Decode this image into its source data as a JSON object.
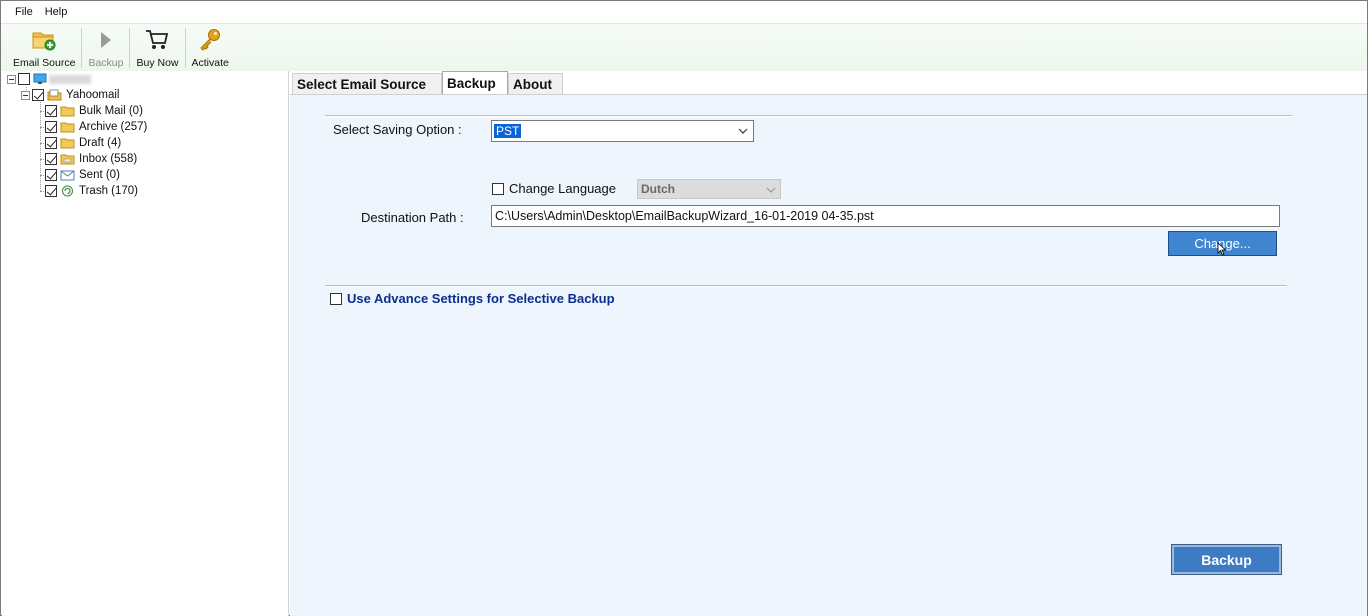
{
  "menu": [
    "File",
    "Help"
  ],
  "toolbar": {
    "email_source": "Email Source",
    "backup": "Backup",
    "buy_now": "Buy Now",
    "activate": "Activate"
  },
  "tree": {
    "account": "Yahoomail",
    "folders": [
      {
        "label": "Bulk Mail (0)",
        "icon": "folder-icon"
      },
      {
        "label": "Archive (257)",
        "icon": "folder-icon"
      },
      {
        "label": "Draft (4)",
        "icon": "folder-icon"
      },
      {
        "label": "Inbox (558)",
        "icon": "inbox-folder-icon"
      },
      {
        "label": "Sent (0)",
        "icon": "sent-folder-icon"
      },
      {
        "label": "Trash (170)",
        "icon": "trash-folder-icon"
      }
    ]
  },
  "tabs": [
    "Select Email Source",
    "Backup",
    "About"
  ],
  "backup": {
    "saving_option_label": "Select Saving Option :",
    "saving_option_value": "PST",
    "change_language_label": "Change Language",
    "language_value": "Dutch",
    "destination_label": "Destination Path :",
    "destination_value": "C:\\Users\\Admin\\Desktop\\EmailBackupWizard_16-01-2019 04-35.pst",
    "change_button": "Change...",
    "advance_settings_label": "Use Advance Settings for Selective Backup",
    "backup_button": "Backup"
  },
  "colors": {
    "button_blue": "#3f85d0",
    "advance_text": "#0a2f8f",
    "panel_bg": "#eef5fc"
  }
}
